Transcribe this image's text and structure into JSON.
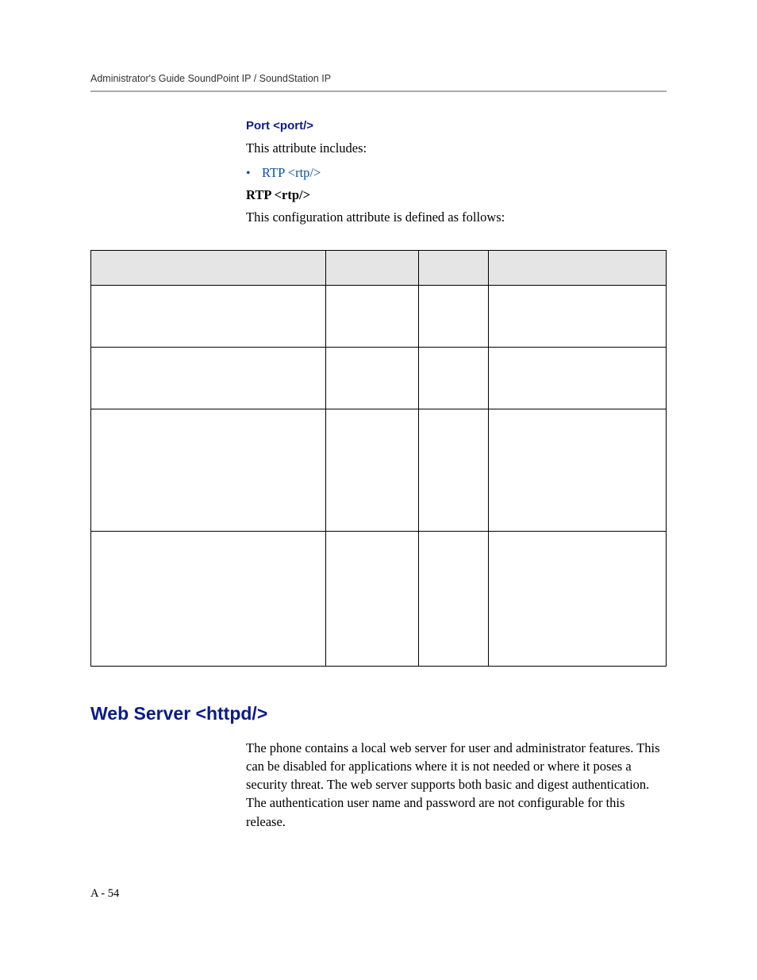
{
  "header": {
    "running": "Administrator's Guide SoundPoint IP / SoundStation IP"
  },
  "port": {
    "heading": "Port <port/>",
    "intro": "This attribute includes:",
    "bullet_link": "RTP <rtp/>",
    "rtp_heading": "RTP <rtp/>",
    "rtp_intro": "This configuration attribute is defined as follows:"
  },
  "httpd": {
    "heading": "Web Server <httpd/>",
    "body": "The phone contains a local web server for user and administrator features. This can be disabled for applications where it is not needed or where it poses a security threat. The web server supports both basic and digest authentication. The authentication user name and password are not configurable for this release."
  },
  "footer": {
    "page": "A - 54"
  }
}
